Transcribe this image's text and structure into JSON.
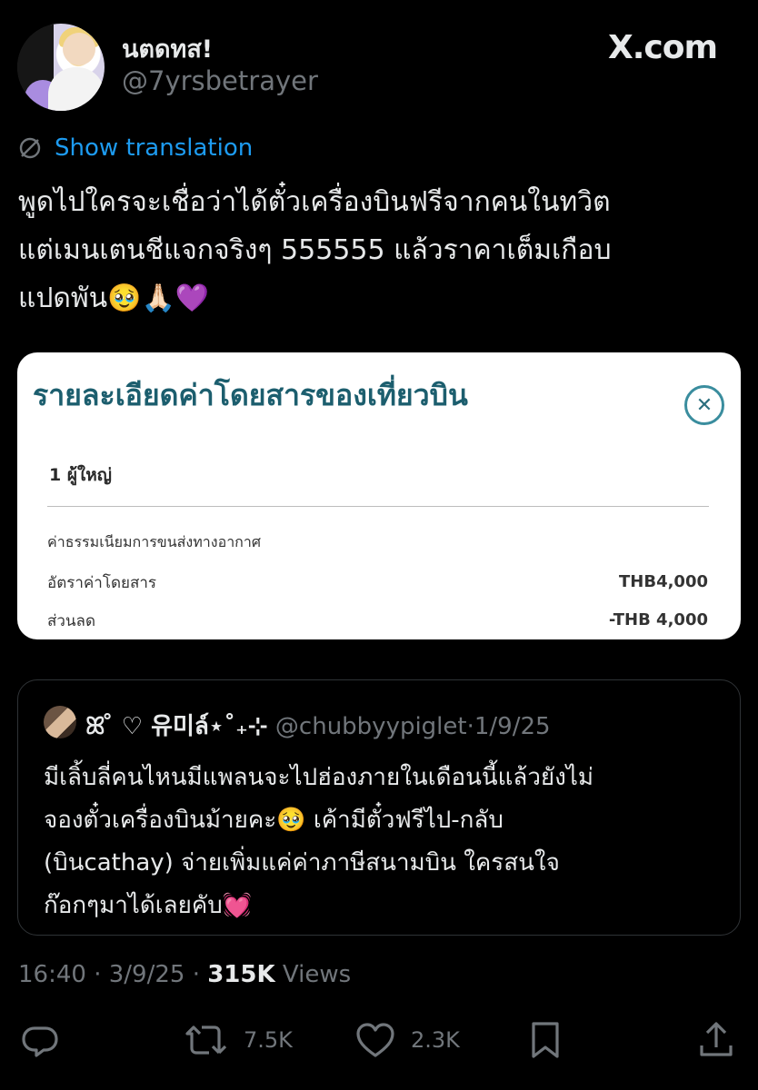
{
  "author": {
    "display_name": "นตดทส!",
    "handle": "@7yrsbetrayer"
  },
  "brand": {
    "logo_text": "X.com"
  },
  "translation": {
    "label": "Show translation"
  },
  "tweet": {
    "text": "พูดไปใครจะเชื่อว่าได้ตั๋วเครื่องบินฟรีจากคนในทวิต\nแต่เมนเตนชีแจกจริงๆ 555555 แล้วราคาเต็มเกือบ\nแปดพัน🥹🙏🏻💜"
  },
  "card": {
    "title": "รายละเอียดค่าโดยสารของเที่ยวบิน",
    "close_symbol": "✕",
    "passengers": "1 ผู้ใหญ่",
    "fee_heading": "ค่าธรรมเนียมการขนส่งทางอากาศ",
    "rows": [
      {
        "label": "อัตราค่าโดยสาร",
        "value": "THB4,000"
      },
      {
        "label": "ส่วนลด",
        "value": "-THB 4,000"
      }
    ]
  },
  "quote": {
    "display_name": "ꕤ ̊ ♡ 유미ล์⋆˚₊⊹",
    "handle": "@chubbyypiglet",
    "date": "1/9/25",
    "text": "มีเลิ้บลี่คนไหนมีแพลนจะไปฮ่องภายในเดือนนี้แล้วยังไม่\nจองตั๋วเครื่องบินม้ายคะ🥹 เค้ามีตั๋วฟรีไป-กลับ\n(บินcathay) จ่ายเพิ่มแค่ค่าภาษีสนามบิน ใครสนใจ\nก๊อกๆมาได้เลยคับ💓"
  },
  "meta": {
    "time": "16:40",
    "date": "3/9/25",
    "views_count": "315K",
    "views_label": "Views"
  },
  "actions": {
    "reply": {
      "icon": "reply-icon"
    },
    "retweet": {
      "icon": "retweet-icon",
      "count": "7.5K"
    },
    "like": {
      "icon": "heart-icon",
      "count": "2.3K"
    },
    "bookmark": {
      "icon": "bookmark-icon"
    },
    "share": {
      "icon": "share-icon"
    }
  },
  "colors": {
    "background": "#000000",
    "text": "#e7e9ea",
    "muted": "#71767b",
    "link": "#1d9bf0",
    "card_title": "#1c5e6e"
  }
}
